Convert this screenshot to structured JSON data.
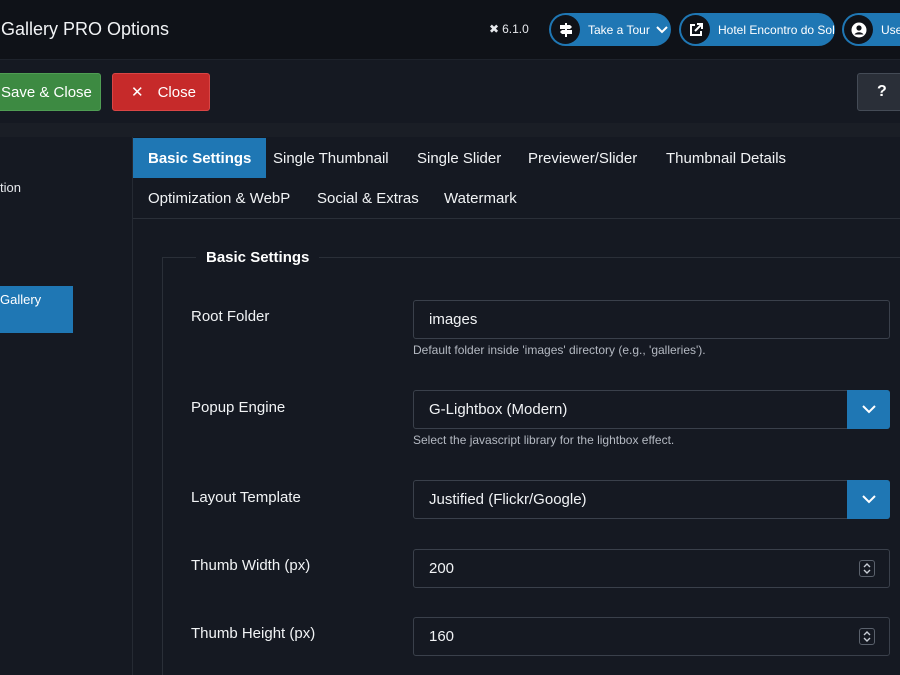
{
  "header": {
    "title": "Gallery PRO Options",
    "version": "6.1.0",
    "take_tour": "Take a Tour",
    "site_name": "Hotel Encontro do Sol",
    "user_label": "User"
  },
  "toolbar": {
    "save_close": "Save & Close",
    "close": "Close",
    "help": "?"
  },
  "sidebar": {
    "items": [
      {
        "label": "tion"
      },
      {
        "label": "Gallery"
      }
    ]
  },
  "tabs": [
    {
      "label": "Basic Settings",
      "active": true
    },
    {
      "label": "Single Thumbnail"
    },
    {
      "label": "Single Slider"
    },
    {
      "label": "Previewer/Slider"
    },
    {
      "label": "Thumbnail Details"
    },
    {
      "label": "Optimization & WebP"
    },
    {
      "label": "Social & Extras"
    },
    {
      "label": "Watermark"
    }
  ],
  "form": {
    "legend": "Basic Settings",
    "root_folder": {
      "label": "Root Folder",
      "value": "images",
      "help": "Default folder inside 'images' directory (e.g., 'galleries')."
    },
    "popup_engine": {
      "label": "Popup Engine",
      "value": "G-Lightbox (Modern)",
      "help": "Select the javascript library for the lightbox effect."
    },
    "layout_template": {
      "label": "Layout Template",
      "value": "Justified (Flickr/Google)"
    },
    "thumb_width": {
      "label": "Thumb Width (px)",
      "value": "200"
    },
    "thumb_height": {
      "label": "Thumb Height (px)",
      "value": "160"
    }
  },
  "colors": {
    "accent": "#1f77b4",
    "save": "#3d8a42",
    "close": "#c62a2a",
    "background": "#151922"
  }
}
